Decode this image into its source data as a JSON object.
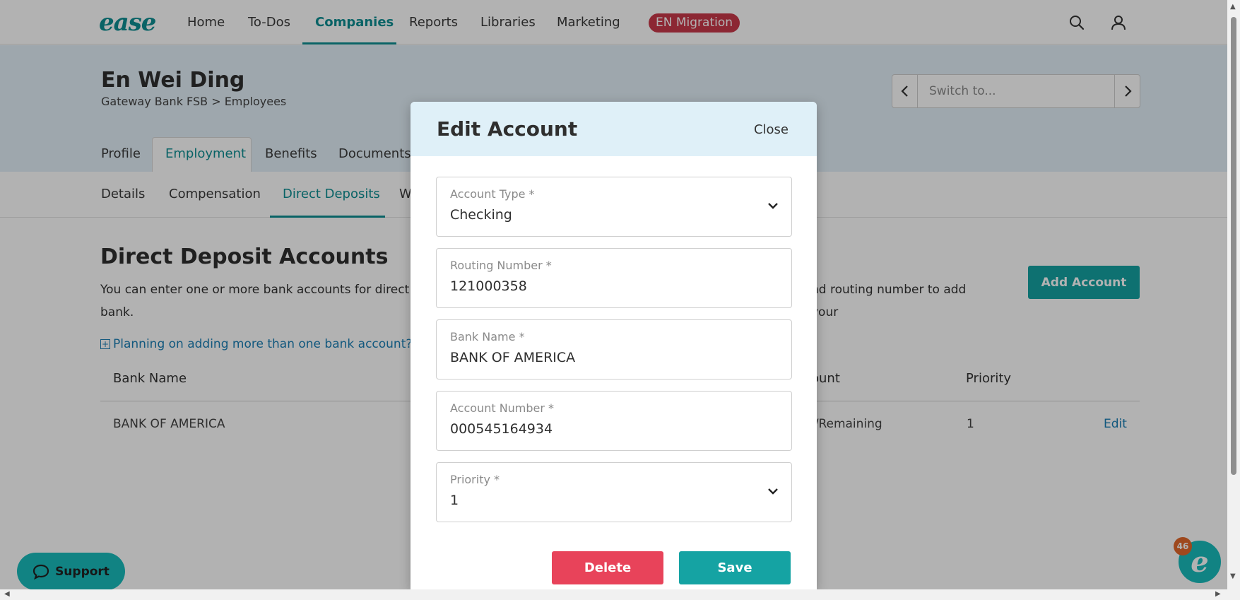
{
  "topnav": {
    "logo": "ease",
    "items": [
      "Home",
      "To-Dos",
      "Companies",
      "Reports",
      "Libraries",
      "Marketing"
    ],
    "active": "Companies",
    "badge": "EN Migration",
    "icons": [
      "search-icon",
      "user-icon"
    ]
  },
  "employee": {
    "name": "En Wei Ding",
    "company": "Gateway Bank FSB",
    "crumb_sep": ">",
    "section": "Employees"
  },
  "switcher": {
    "placeholder": "Switch to..."
  },
  "tabs": [
    "Profile",
    "Employment",
    "Benefits",
    "Documents"
  ],
  "active_tab": "Employment",
  "subtabs": [
    "Details",
    "Compensation",
    "Direct Deposits",
    "W"
  ],
  "active_subtab": "Direct Deposits",
  "page": {
    "title": "Direct Deposit Accounts",
    "description_left": "You can enter one or more bank accounts for direct de",
    "description_right": "nd routing number to add your",
    "description_line2": "bank.",
    "add_button": "Add Account",
    "planning_link": "Planning on adding more than one bank account?"
  },
  "table": {
    "headers": [
      "Bank Name",
      "ount",
      "Priority"
    ],
    "rows": [
      {
        "bank": "BANK OF AMERICA",
        "amount": "l/Remaining",
        "priority": "1",
        "action": "Edit"
      }
    ]
  },
  "support": {
    "label": "Support"
  },
  "chat": {
    "count": "46",
    "glyph": "e"
  },
  "modal": {
    "title": "Edit Account",
    "close": "Close",
    "fields": [
      {
        "label": "Account Type *",
        "value": "Checking",
        "type": "select"
      },
      {
        "label": "Routing Number *",
        "value": "121000358",
        "type": "input"
      },
      {
        "label": "Bank Name *",
        "value": "BANK OF AMERICA",
        "type": "input"
      },
      {
        "label": "Account Number *",
        "value": "000545164934",
        "type": "input"
      },
      {
        "label": "Priority *",
        "value": "1",
        "type": "select"
      }
    ],
    "delete": "Delete",
    "save": "Save"
  },
  "colors": {
    "brand": "#0e8f93",
    "accent": "#15a3a3",
    "danger": "#e8435a",
    "badge": "#c9384a",
    "link": "#1a7fb5"
  }
}
